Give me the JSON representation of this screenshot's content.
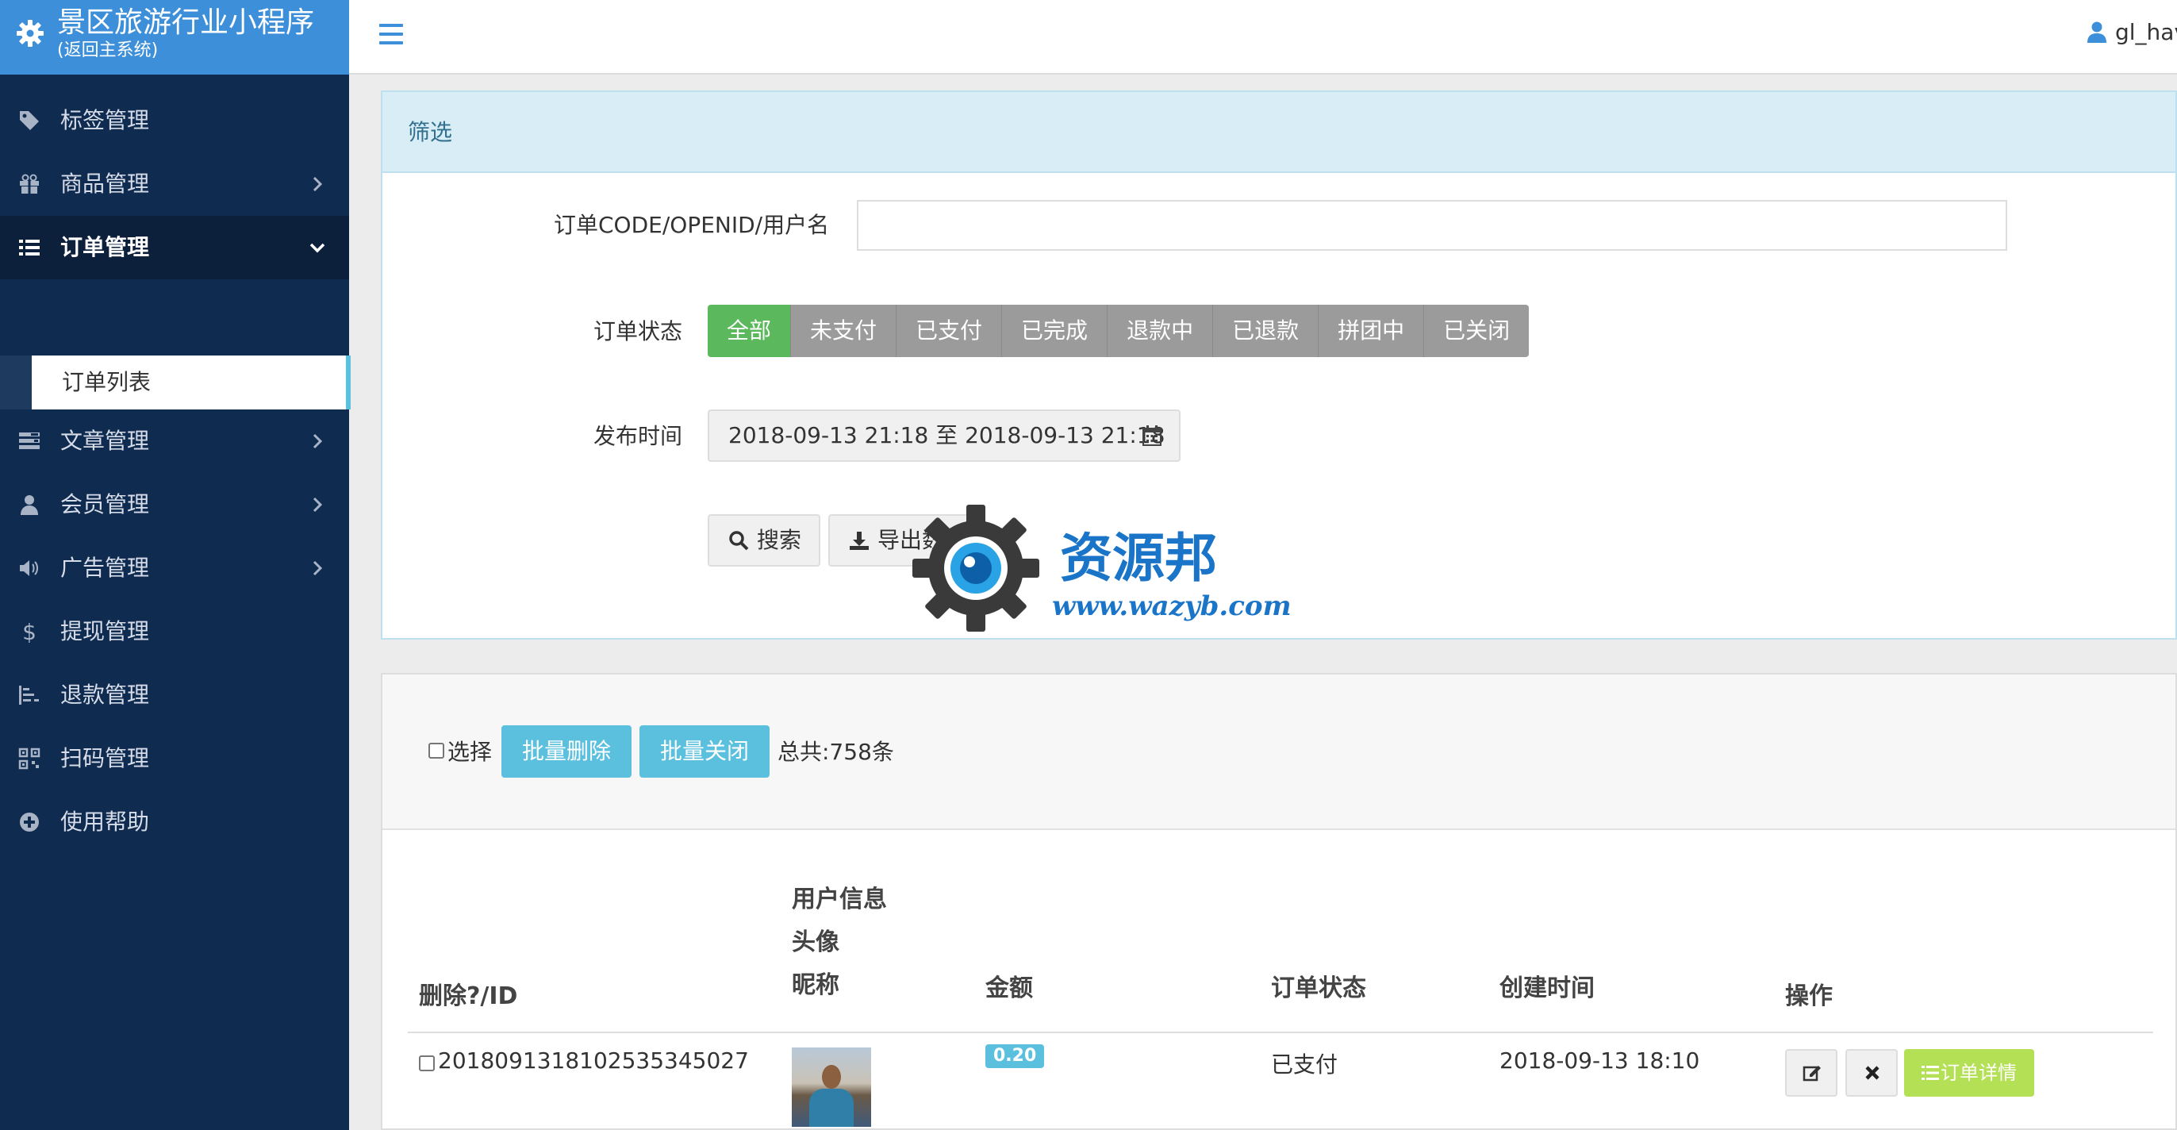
{
  "brand": {
    "title": "景区旅游行业小程序",
    "subtitle": "(返回主系统)",
    "icon": "gear-icon",
    "color": "#3d8fd9"
  },
  "sidebar": {
    "background": "#102b50",
    "items": [
      {
        "label": "标签管理",
        "icon": "tag-icon",
        "has_children": false
      },
      {
        "label": "商品管理",
        "icon": "gift-icon",
        "has_children": true
      },
      {
        "label": "订单管理",
        "icon": "list-icon",
        "has_children": true,
        "expanded": true,
        "active": true
      },
      {
        "label": "文章管理",
        "icon": "tasks-icon",
        "has_children": true
      },
      {
        "label": "会员管理",
        "icon": "user-icon",
        "has_children": true
      },
      {
        "label": "广告管理",
        "icon": "volume-icon",
        "has_children": true
      },
      {
        "label": "提现管理",
        "icon": "dollar-icon",
        "has_children": false
      },
      {
        "label": "退款管理",
        "icon": "align-icon",
        "has_children": false
      },
      {
        "label": "扫码管理",
        "icon": "qrcode-icon",
        "has_children": false
      },
      {
        "label": "使用帮助",
        "icon": "plus-circle-icon",
        "has_children": false
      }
    ],
    "subitem": {
      "label": "订单列表"
    }
  },
  "topbar": {
    "menu_icon": "hamburger-icon",
    "username": "gl_hav"
  },
  "filter": {
    "header": "筛选",
    "code_label": "订单CODE/OPENID/用户名",
    "code_value": "",
    "status_label": "订单状态",
    "statuses": [
      "全部",
      "未支付",
      "已支付",
      "已完成",
      "退款中",
      "已退款",
      "拼团中",
      "已关闭"
    ],
    "selected_status": "全部",
    "time_label": "发布时间",
    "time_range": "2018-09-13 21:18 至 2018-09-13 21:18",
    "search_label": "搜索",
    "export_label": "导出数据"
  },
  "watermark": {
    "text": "资源邦",
    "url": "www.wazyb.com"
  },
  "list": {
    "select_label": "选择",
    "batch_delete_label": "批量删除",
    "batch_close_label": "批量关闭",
    "total_text": "总共:758条",
    "columns": {
      "id": "删除?/ID",
      "user_info": "用户信息",
      "avatar": "头像",
      "nickname": "昵称",
      "amount": "金额",
      "status": "订单状态",
      "created": "创建时间",
      "actions": "操作"
    },
    "rows": [
      {
        "id": "2018091318102535345027",
        "amount": "0.20",
        "status": "已支付",
        "created": "2018-09-13 18:10",
        "detail_label": "订单详情"
      }
    ]
  }
}
